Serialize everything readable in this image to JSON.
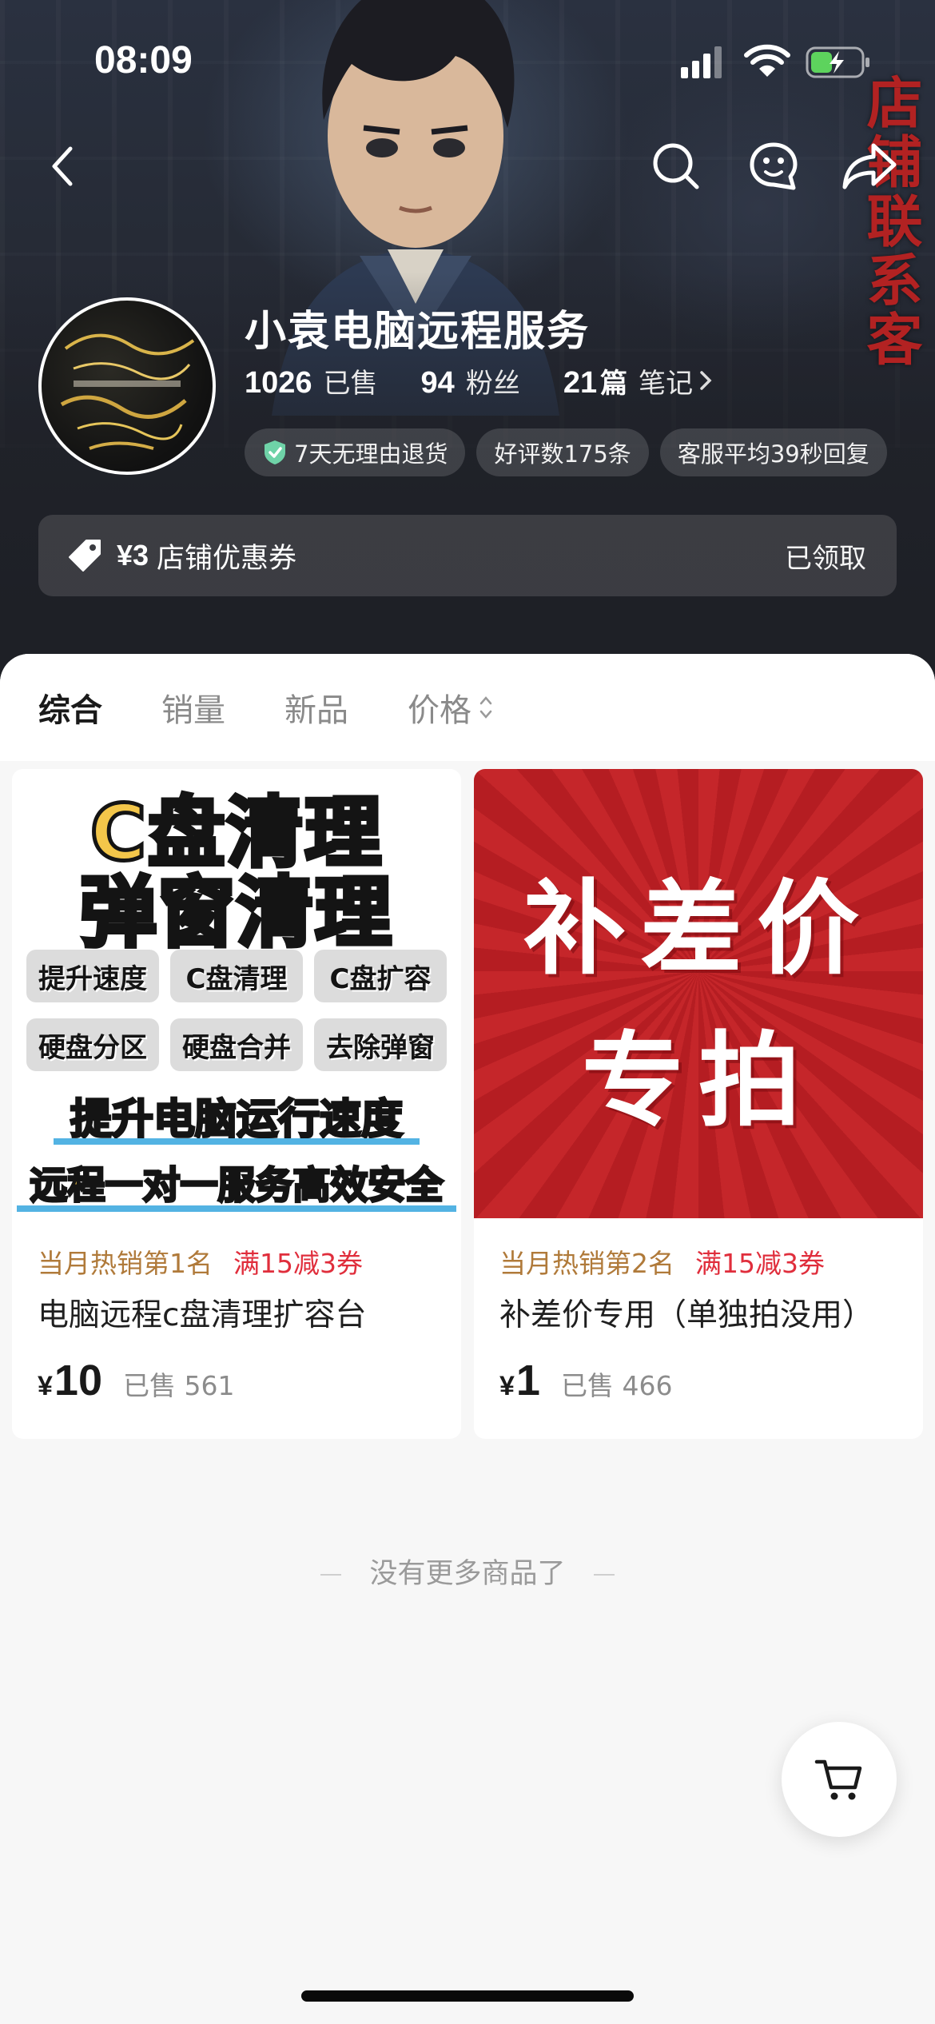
{
  "status_bar": {
    "time": "08:09"
  },
  "side_banner": {
    "text": "店铺联系客"
  },
  "store": {
    "name": "小袁电脑远程服务",
    "sold_count": "1026",
    "sold_label": "已售",
    "fans_count": "94",
    "fans_label": "粉丝",
    "notes_count": "21",
    "notes_unit": "篇",
    "notes_label": "笔记"
  },
  "tags": [
    {
      "label": "7天无理由退货",
      "icon": "shield-check-icon"
    },
    {
      "label": "好评数175条"
    },
    {
      "label": "客服平均39秒回复"
    }
  ],
  "coupon": {
    "amount": "¥3",
    "title": "店铺优惠券",
    "status": "已领取"
  },
  "sort_tabs": [
    "综合",
    "销量",
    "新品",
    "价格"
  ],
  "products": [
    {
      "image_text": {
        "headline_1": "C盘清理",
        "headline_2": "弹窗清理",
        "chips_row_1": [
          "提升速度",
          "C盘清理",
          "C盘扩容"
        ],
        "chips_row_2": [
          "硬盘分区",
          "硬盘合并",
          "去除弹窗"
        ],
        "line_1": "提升电脑运行速度",
        "line_2": "远程一对一服务高效安全"
      },
      "hot_tag": "当月热销第1名",
      "promo_tag": "满15减3券",
      "title": "电脑远程c盘清理扩容台",
      "currency": "¥",
      "price": "10",
      "sold": "已售 561"
    },
    {
      "image_text": {
        "line_1": "补差价",
        "line_2": "专拍"
      },
      "hot_tag": "当月热销第2名",
      "promo_tag": "满15减3券",
      "title": "补差价专用（单独拍没用）",
      "currency": "¥",
      "price": "1",
      "sold": "已售 466"
    }
  ],
  "footer": {
    "no_more": "没有更多商品了"
  },
  "colors": {
    "hero_bg": "#232630",
    "banner_red": "#b22222",
    "promo_red": "#e02e3c",
    "hot_brown": "#b07a3a",
    "image_yellow": "#f3c64a",
    "image_red": "#c5262a",
    "shield_green": "#6fd3a8"
  },
  "icons": [
    "back-arrow-icon",
    "search-icon",
    "chat-icon",
    "share-icon",
    "coupon-tag-icon",
    "chevron-right-icon",
    "sort-arrows-icon",
    "cart-icon"
  ]
}
